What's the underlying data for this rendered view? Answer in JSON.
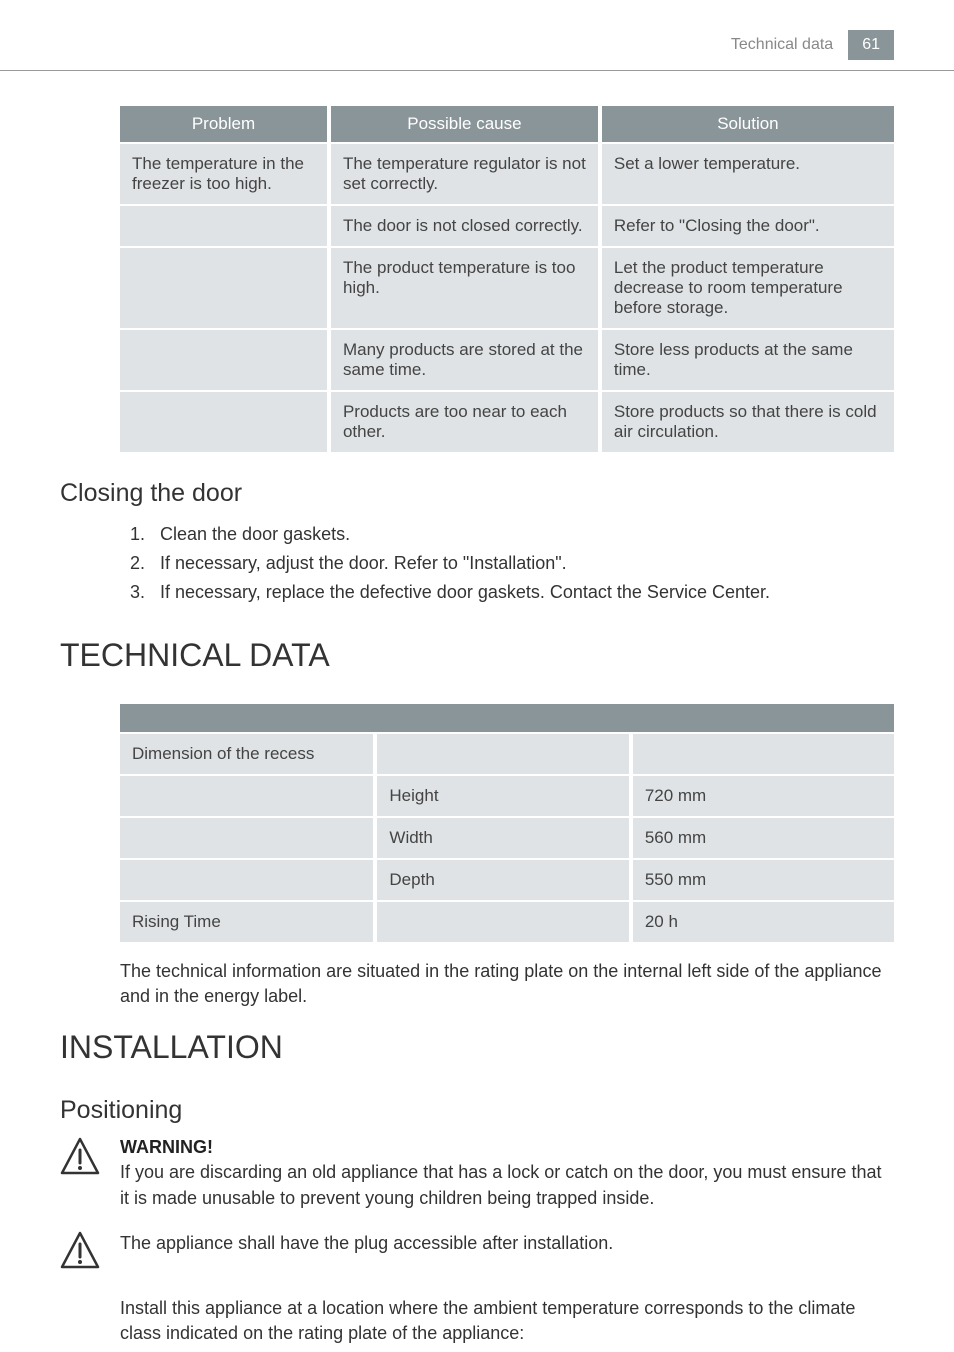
{
  "header": {
    "title": "Technical data",
    "page_number": "61"
  },
  "troubleshoot_table": {
    "headers": [
      "Problem",
      "Possible cause",
      "Solution"
    ],
    "rows": [
      {
        "problem": "The temperature in the freezer is too high.",
        "cause": "The temperature regulator is not set correctly.",
        "solution": "Set a lower temperature."
      },
      {
        "problem": "",
        "cause": "The door is not closed correctly.",
        "solution": "Refer to \"Closing the door\"."
      },
      {
        "problem": "",
        "cause": "The product temperature is too high.",
        "solution": "Let the product temperature decrease to room temperature before storage."
      },
      {
        "problem": "",
        "cause": "Many products are stored at the same time.",
        "solution": "Store less products at the same time."
      },
      {
        "problem": "",
        "cause": "Products are too near to each other.",
        "solution": "Store products so that there is cold air circulation."
      }
    ]
  },
  "closing_door": {
    "title": "Closing the door",
    "steps": [
      "Clean the door gaskets.",
      "If necessary, adjust the door. Refer to \"Installation\".",
      "If necessary, replace the defective door gaskets. Contact the Service Center."
    ]
  },
  "technical_data": {
    "title": "TECHNICAL DATA",
    "rows": [
      {
        "c1": "Dimension of the recess",
        "c2": "",
        "c3": ""
      },
      {
        "c1": "",
        "c2": "Height",
        "c3": "720 mm"
      },
      {
        "c1": "",
        "c2": "Width",
        "c3": "560 mm"
      },
      {
        "c1": "",
        "c2": "Depth",
        "c3": "550 mm"
      },
      {
        "c1": "Rising Time",
        "c2": "",
        "c3": "20 h"
      }
    ],
    "note": "The technical information are situated in the rating plate on the internal left side of the appliance and in the energy label."
  },
  "installation": {
    "title": "INSTALLATION",
    "positioning": {
      "title": "Positioning",
      "warning_label": "WARNING!",
      "warning_text": "If you are discarding an old appliance that has a lock or catch on the door, you must ensure that it is made unusable to prevent young children being trapped inside.",
      "notice_text": "The appliance shall have the plug accessible after installation.",
      "body_text": "Install this appliance at a location where the ambient temperature corresponds to the climate class indicated on the rating plate of the appliance:"
    }
  }
}
